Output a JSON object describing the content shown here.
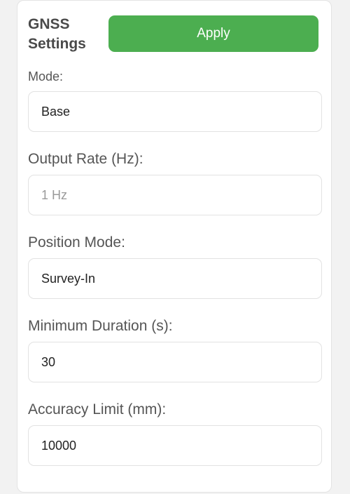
{
  "settings": {
    "title": "GNSS Settings",
    "apply_label": "Apply",
    "mode": {
      "label": "Mode:",
      "value": "Base"
    },
    "output_rate": {
      "label": "Output Rate (Hz):",
      "value": "1 Hz"
    },
    "position_mode": {
      "label": "Position Mode:",
      "value": "Survey-In"
    },
    "minimum_duration": {
      "label": "Minimum Duration (s):",
      "value": "30"
    },
    "accuracy_limit": {
      "label": "Accuracy Limit (mm):",
      "value": "10000"
    }
  },
  "colors": {
    "accent": "#4cae50",
    "background": "#f2f2f2",
    "card": "#ffffff",
    "text": "#555555",
    "muted": "#9a9a9a"
  }
}
